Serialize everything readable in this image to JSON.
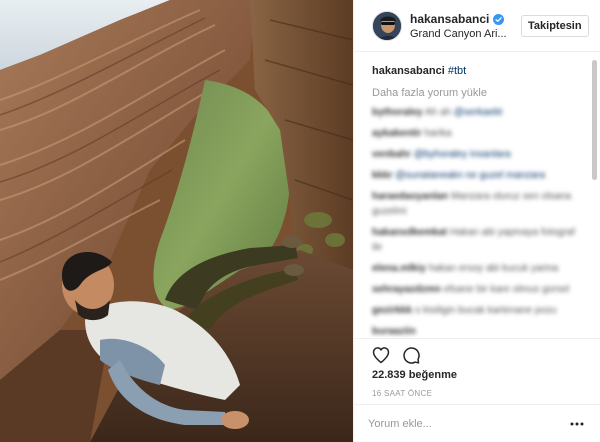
{
  "post": {
    "username": "hakansabanci",
    "location": "Grand Canyon Ari...",
    "follow_label": "Takiptesin",
    "caption_tag": "#tbt",
    "load_more": "Daha fazla yorum yükle",
    "likes": "22.839 beğenme",
    "timestamp": "16 SAAT ÖNCE",
    "comment_placeholder": "Yorum ekle...",
    "comments": [
      {
        "user": "bythoraley",
        "text": "Ah ah",
        "mention": "@serkaebt"
      },
      {
        "user": "aykakentir",
        "text": "harika",
        "mention": ""
      },
      {
        "user": "venbahr",
        "text": "",
        "mention": "@byhoraley  insanlara"
      },
      {
        "user": "kkkr",
        "text": "",
        "mention": "@sunataneakn  ne guzel manzara"
      },
      {
        "user": "haraedaoyanlan",
        "text": "Manzara oluruz sen olsana guzelmi",
        "mention": ""
      },
      {
        "user": "hakanxdkemkat",
        "text": "Hakan abi yapmaya fotograf ile",
        "mention": ""
      },
      {
        "user": "elena.mlkiy",
        "text": "hakan ersoy abi kucuk yarina",
        "mention": ""
      },
      {
        "user": "sehrayazdzmn",
        "text": "efsane bir kare olmus gorsel",
        "mention": ""
      },
      {
        "user": "gezirkkk",
        "text": "o kisiligin bucak kartenane pozu",
        "mention": ""
      },
      {
        "user": "buraaziin",
        "text": "",
        "mention": ""
      }
    ]
  },
  "colors": {
    "verified": "#3897f0",
    "mention": "#003569",
    "muted": "#999999",
    "border": "#efefef"
  },
  "icons": [
    "verified-badge-icon",
    "heart-icon",
    "comment-bubble-icon",
    "more-options-icon"
  ]
}
